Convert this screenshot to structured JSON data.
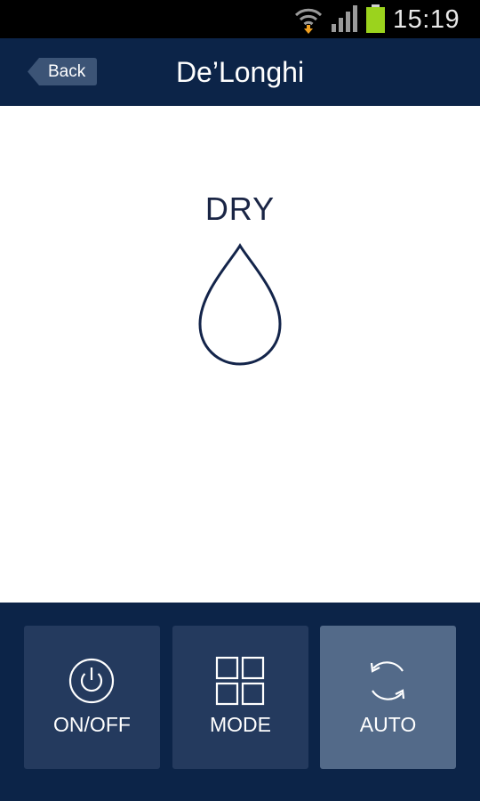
{
  "status_bar": {
    "time": "15:19"
  },
  "header": {
    "back_label": "Back",
    "title": "De’Longhi"
  },
  "main": {
    "mode_label": "DRY",
    "mode_icon": "water-drop-icon"
  },
  "controls": [
    {
      "label": "ON/OFF",
      "icon": "power-icon",
      "active": false
    },
    {
      "label": "MODE",
      "icon": "grid-icon",
      "active": false
    },
    {
      "label": "AUTO",
      "icon": "refresh-icon",
      "active": true
    }
  ],
  "colors": {
    "header_bg": "#0c2448",
    "button_bg": "#243a5e",
    "button_active_bg": "#536a89",
    "battery": "#9bd31d",
    "wifi_arrow": "#f0a020"
  }
}
